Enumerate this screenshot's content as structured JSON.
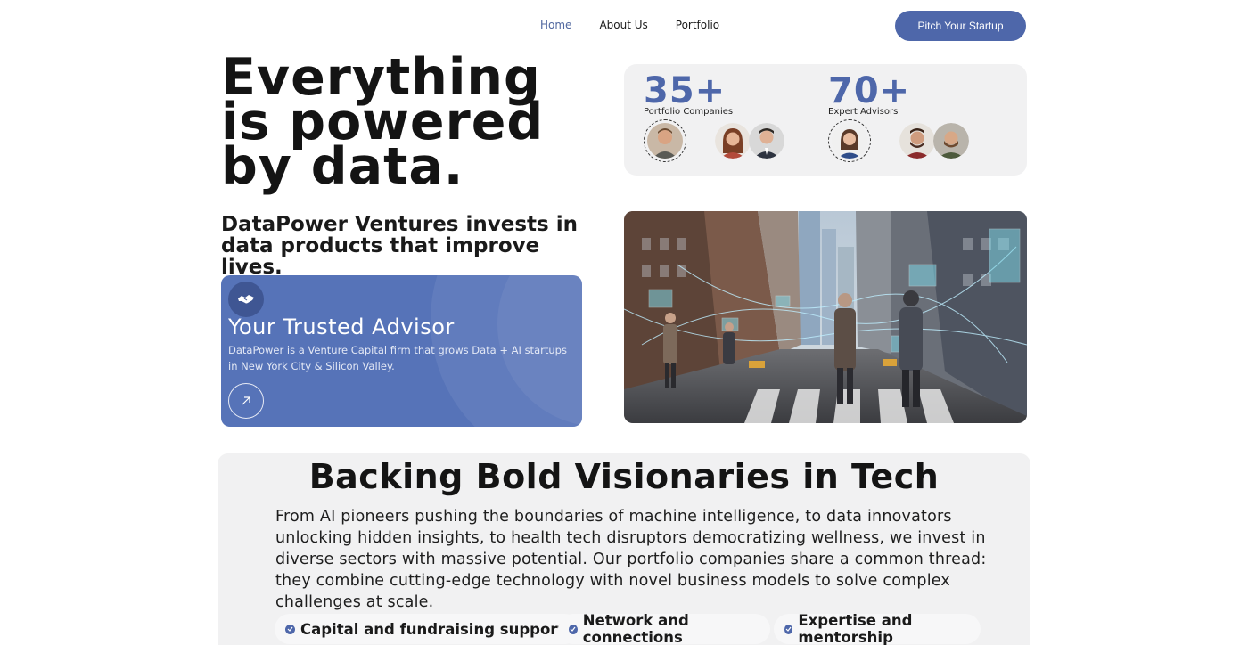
{
  "nav": {
    "links": [
      "Home",
      "About Us",
      "Portfolio"
    ],
    "active_link": "Home",
    "cta_label": "Pitch Your Startup",
    "accent_color": "#4e67aa"
  },
  "hero": {
    "title": "Everything is powered by data.",
    "subtitle": "DataPower Ventures invests in data products that improve lives."
  },
  "stats": [
    {
      "number": "35+",
      "label": "Portfolio Companies"
    },
    {
      "number": "70+",
      "label": "Expert Advisors"
    }
  ],
  "advisor_card": {
    "icon": "handshake-icon",
    "title": "Your Trusted Advisor",
    "text": "DataPower is a Venture Capital firm that grows Data + AI startups in New York City & Silicon Valley.",
    "action_icon": "arrow-up-right-icon",
    "background_color": "#5673b8"
  },
  "section": {
    "title": "Backing Bold Visionaries in Tech",
    "body": "From AI pioneers pushing the boundaries of machine intelligence, to data innovators unlocking hidden insights, to health tech disruptors democratizing wellness, we invest in diverse sectors with massive potential. Our portfolio companies share a common thread: they combine cutting-edge technology with novel business models to solve complex challenges at scale.",
    "pills": [
      "Capital and fundraising support",
      "Network and connections",
      "Expertise and mentorship"
    ]
  }
}
